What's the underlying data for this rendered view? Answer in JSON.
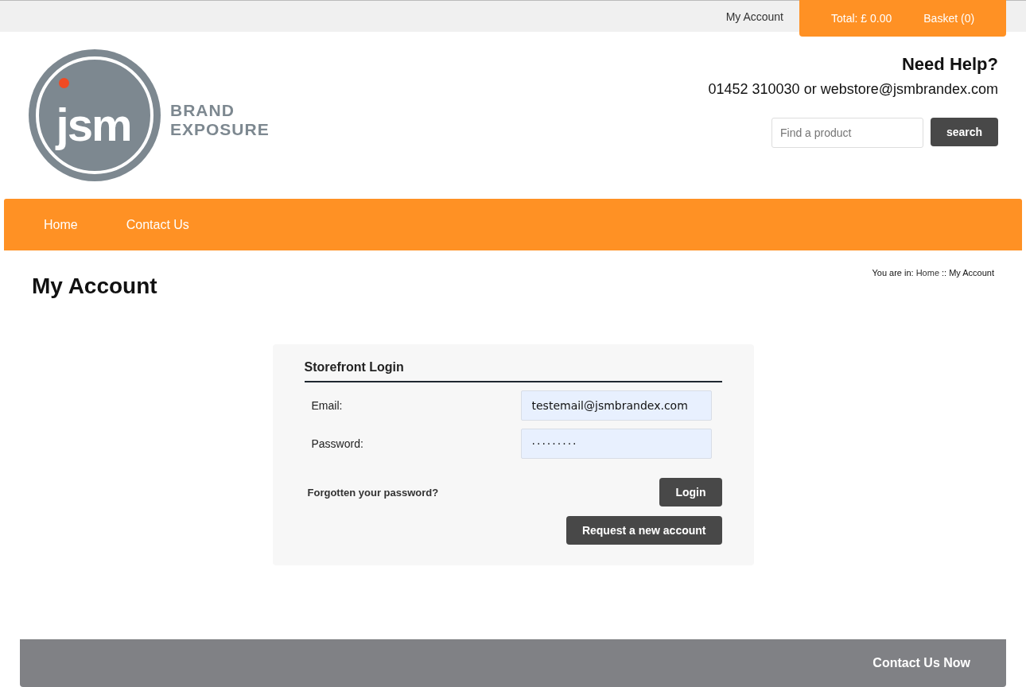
{
  "top_bar": {
    "account_link": "My Account",
    "total": "Total: £ 0.00",
    "basket": "Basket (0)"
  },
  "header": {
    "logo": {
      "mark": "jsm",
      "line_1": "BRAND",
      "line_2": "EXPOSURE"
    },
    "help_title": "Need Help?",
    "help_contact": "01452 310030 or webstore@jsmbrandex.com",
    "search": {
      "placeholder": "Find a product",
      "button": "search"
    }
  },
  "nav": {
    "items": [
      {
        "label": "Home"
      },
      {
        "label": "Contact Us"
      }
    ]
  },
  "breadcrumb": {
    "label": "You are in:",
    "separator": "::",
    "items": [
      {
        "text": "Home",
        "kind": "link"
      },
      {
        "text": "My Account",
        "kind": "current"
      }
    ]
  },
  "page_title": "My Account",
  "login": {
    "title": "Storefront Login",
    "fields": [
      {
        "label": "Email:",
        "value": "testemail@jsmbrandex.com",
        "kind": "text"
      },
      {
        "label": "Password:",
        "value": "·········",
        "kind": "password"
      }
    ],
    "forgot_link": "Forgotten your password?",
    "login_button": "Login",
    "request_button": "Request a new account"
  },
  "footer": {
    "contact_button": "Contact Us Now"
  }
}
